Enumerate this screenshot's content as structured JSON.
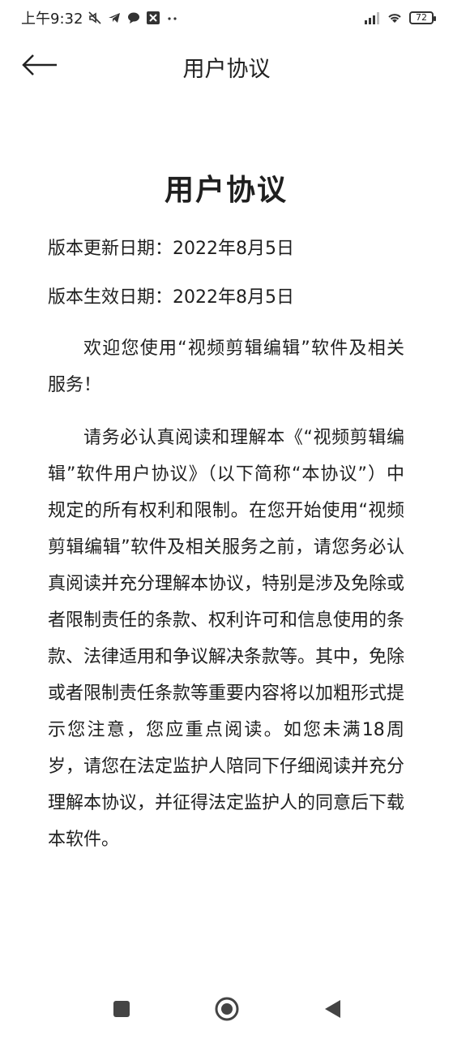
{
  "status_bar": {
    "time": "上午9:32",
    "battery": "72",
    "icons": [
      "mute-icon",
      "telegram-icon",
      "chat-icon",
      "app-icon",
      "more-dots-icon",
      "signal-icon",
      "wifi-icon",
      "battery-icon"
    ]
  },
  "header": {
    "title": "用户协议",
    "back_icon": "arrow-left-icon"
  },
  "document": {
    "title": "用户协议",
    "updated": "版本更新日期：2022年8月5日",
    "effective": "版本生效日期：2022年8月5日",
    "paragraphs": [
      "欢迎您使用“视频剪辑编辑”软件及相关服务！",
      "请务必认真阅读和理解本《“视频剪辑编辑”软件用户协议》（以下简称“本协议”）中规定的所有权利和限制。在您开始使用“视频剪辑编辑”软件及相关服务之前，请您务必认真阅读并充分理解本协议，特别是涉及免除或者限制责任的条款、权利许可和信息使用的条款、法律适用和争议解决条款等。其中，免除或者限制责任条款等重要内容将以加粗形式提示您注意，您应重点阅读。如您未满18周岁，请您在法定监护人陪同下仔细阅读并充分理解本协议，并征得法定监护人的同意后下载本软件。"
    ]
  },
  "nav": {
    "icons": [
      "recents-square-icon",
      "home-circle-icon",
      "back-triangle-icon"
    ]
  }
}
